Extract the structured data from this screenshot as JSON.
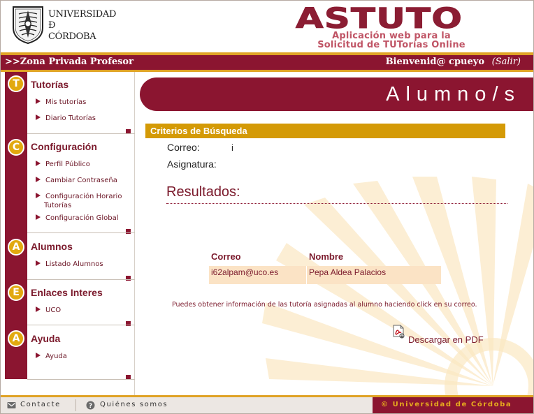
{
  "header": {
    "university_line1": "UNIVERSIDAD",
    "university_line2": "Ð",
    "university_line3": "CÓRDOBA",
    "app_title": "ASTUTO",
    "app_subtitle_line1": "Aplicación web para la",
    "app_subtitle_line2": "Solicitud de TUTorías Online"
  },
  "topbar": {
    "zone": ">>Zona Privada Profesor",
    "welcome": "Bienvenid@ cpueyo",
    "logout": "(Salir)"
  },
  "sidebar": {
    "sections": [
      {
        "letter": "T",
        "title": "Tutorías",
        "items": [
          "Mis tutorías",
          "Diario Tutorías"
        ]
      },
      {
        "letter": "C",
        "title": "Configuración",
        "items": [
          "Perfil Público",
          "Cambiar Contraseña",
          "Configuración Horario",
          "Configuración Global"
        ],
        "item_continuation": "Tutorías"
      },
      {
        "letter": "A",
        "title": "Alumnos",
        "items": [
          "Listado Alumnos"
        ]
      },
      {
        "letter": "E",
        "title": "Enlaces Interes",
        "items": [
          "UCO"
        ]
      },
      {
        "letter": "A",
        "title": "Ayuda",
        "items": [
          "Ayuda"
        ]
      }
    ]
  },
  "main": {
    "page_title": "Alumno/s",
    "criteria_title": "Criterios de Búsqueda",
    "criteria": {
      "email_label": "Correo:",
      "email_value": "i",
      "subject_label": "Asignatura:",
      "subject_value": ""
    },
    "results_title": "Resultados:",
    "table": {
      "headers": [
        "Correo",
        "Nombre"
      ],
      "rows": [
        [
          "i62alpam@uco.es",
          "Pepa Aldea Palacios"
        ]
      ]
    },
    "info": "Puedes obtener información de las tutoría asignadas al alumno haciendo click en su correo.",
    "pdf_link": "Descargar en PDF"
  },
  "footer": {
    "contact": "Contacte",
    "about": "Quiénes somos",
    "copyright": "© Universidad de Córdoba"
  },
  "colors": {
    "primary": "#8b1530",
    "accent": "#e0a326",
    "criteria_bar": "#d49a06",
    "row_bg": "#fbe3c5"
  },
  "icons": [
    "uco-logo-icon",
    "pdf-icon",
    "mail-icon",
    "info-icon"
  ]
}
